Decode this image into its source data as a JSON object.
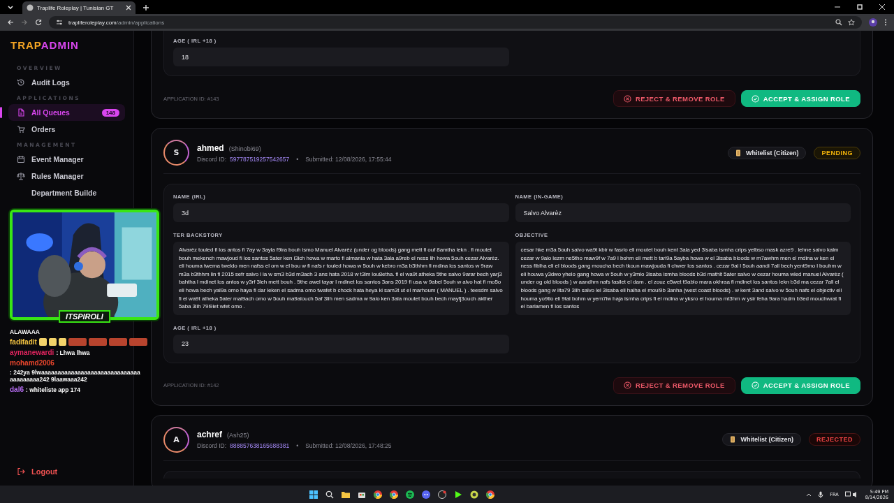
{
  "browser": {
    "tab_title": "Traplife Roleplay | Tunisian GT",
    "url_host": "trapliferoleplay.com",
    "url_path": "/admin/applications"
  },
  "sidebar": {
    "logo_left": "TRAP",
    "logo_right": "ADMIN",
    "sections": [
      {
        "title": "OVERVIEW",
        "items": [
          {
            "label": "Audit Logs",
            "selected": false
          }
        ]
      },
      {
        "title": "APPLICATIONS",
        "items": [
          {
            "label": "All Queues",
            "selected": true,
            "badge": "148"
          },
          {
            "label": "Orders",
            "selected": false
          }
        ]
      },
      {
        "title": "MANAGEMENT",
        "items": [
          {
            "label": "Event Manager",
            "selected": false
          },
          {
            "label": "Rules Manager",
            "selected": false
          },
          {
            "label": "Department Builde",
            "selected": false
          }
        ]
      }
    ],
    "logout": "Logout"
  },
  "applications": [
    {
      "fields": [
        {
          "label": "AGE ( IRL +18 )",
          "value": "18",
          "kind": "short"
        }
      ],
      "app_id": "APPLICATION ID: #143",
      "actions": [
        {
          "label": "REJECT & REMOVE ROLE",
          "kind": "reject"
        },
        {
          "label": "ACCEPT & ASSIGN ROLE",
          "kind": "accept"
        }
      ]
    },
    {
      "avatar": "S",
      "name": "ahmed",
      "handle": "(Shinobi69)",
      "discord_label": "Discord ID:",
      "discord_id": "597787519257542657",
      "separator": "•",
      "submitted": "Submitted: 12/08/2026, 17:55:44",
      "role": "Whitelist (Citizen)",
      "status": {
        "label": "PENDING",
        "kind": "pending"
      },
      "fields": [
        {
          "label": "NAME (IRL)",
          "value": "3d",
          "kind": "short"
        },
        {
          "label": "NAME (IN-GAME)",
          "value": "Salvo Alvarèz",
          "kind": "short"
        },
        {
          "label": "TER BACKSTORY",
          "value": "Alvarèz touled fi los antos fi 7ay w 3ayla f9ira bouh ismo Manuel Alvarèz (under og bloods) gang mett fi ouf 8amtha lekn . fi moutet bouh mekench mawjoud fi los santos 5ater ken i3ich howa w marto  fi almania w hata 3ala a9reb el ness lih howa 5ouh cezar Alvarèz. eli houma twema tweldo men nafss el om w el bou w fi nafs r touled howa w 5ouh w kebro m3a b3thhm fi mdina los santos w 9raw m3a b3thhm lin fi 2015  sefr salvo l ia w sm3 b3d m3ach 3 ans hata 2018 w t3lm lou8etha. fi el wa9t atheka 5the salvo 9arar bech yarj3 bahtha l mdinet los antos w y3rf 3leh mett bouh . 5the awel tayar l mdinet los santos 3ans 2019 fi usa w 9abel 5ouh w alvo hat fi mo5o eli howa bech yal9a omo haya fi dar leken el sadma omo twafet b chock hata heya ki sam3t ut el marhoum ( MANUEL ) . teesdm salvo fi el wa9t atheka 5ater mal9ach omo w 5ouh ma9alouch 5af 3lih men sadma w 9alo ken 3ala moutet bouh bech mayfj3ouch akther 5aba 3lih 79i9iet wfet omo .",
          "kind": "long"
        },
        {
          "label": "OBJECTIVE",
          "value": "cesar hke m3a 5ouh salvo wa9t kbir w fasrlo eli moutet bouh kent 3ala yed 3isaba ismha crips yelbso mask azre9 . lehne salvo kalm cezar w 9alo lezm ne5tho maw9f w 7a9 l bohm eli mett b tari9a 5ayba howa w el 3isaba bloods w m7awhm men el mdina w ken el ness fiblha eli el bloods gang moucha bech tkoun mawjouda fi chwer los santos . cezar 9al l 5ouh aandi 7all bech yent9mo l bouhm w eli houwa y3dwo yhelo gang howa w 5ouh w y3mlo 3isaba ismha bloods b3d mathlt 5ater salvo w cezar houma wled manuel Alvarèz ( under og old bloods ) w aandhm nafs fasilet el dam . el zouz e5wet t9ablo mara okhraa fi mdinet los santos lekn b3d ma cezar 7all el bloods gang w ilta79 3lih salvo lel 3isaba eli halha  el moul9b 3anha (west coast bloods) . w kent 3and salvo w 5ouh nafs el objectiv eli houma yo9tlo eli 9tal bohm w yem7iw haja ismha crips fi el mdina w yksro el houma mt3hm w ysir feha 9ara hadm b3ed mouchwrat fi el barlamen fi los santos",
          "kind": "long"
        },
        {
          "label": "AGE ( IRL +18 )",
          "value": "23",
          "kind": "short"
        }
      ],
      "app_id": "APPLICATION ID: #142",
      "actions": [
        {
          "label": "REJECT & REMOVE ROLE",
          "kind": "reject"
        },
        {
          "label": "ACCEPT & ASSIGN ROLE",
          "kind": "accept"
        }
      ]
    },
    {
      "avatar": "A",
      "name": "achref",
      "handle": "(Ash25)",
      "discord_label": "Discord ID:",
      "discord_id": "888857638165688381",
      "separator": "•",
      "submitted": "Submitted: 12/08/2026, 17:48:25",
      "role": "Whitelist (Citizen)",
      "status": {
        "label": "REJECTED",
        "kind": "rejected"
      }
    }
  ],
  "stream_overlay": {
    "streamer": "ITSPIROLI",
    "chat": [
      {
        "text": "ALAWAAA"
      },
      {
        "user": "fadifadit",
        "color": "#f5c542",
        "emotes": true
      },
      {
        "user": "aymanewardi",
        "color": "#e0245e",
        "text": ": Lhwa lhwa"
      },
      {
        "user": "mohamd2006",
        "color": "#e8452c",
        "text": ": 242ya 9lwaaaaaaaaaaaaaaaaaaaaaaaaaaaaaa aaaaaaaaa242 9laawaaa242"
      },
      {
        "user": "dal6",
        "color": "#b46cf0",
        "text": ": whiteliste app 174"
      }
    ]
  },
  "taskbar": {
    "language": "FRA",
    "time": "5:49 PM",
    "date": "8/14/2026"
  }
}
